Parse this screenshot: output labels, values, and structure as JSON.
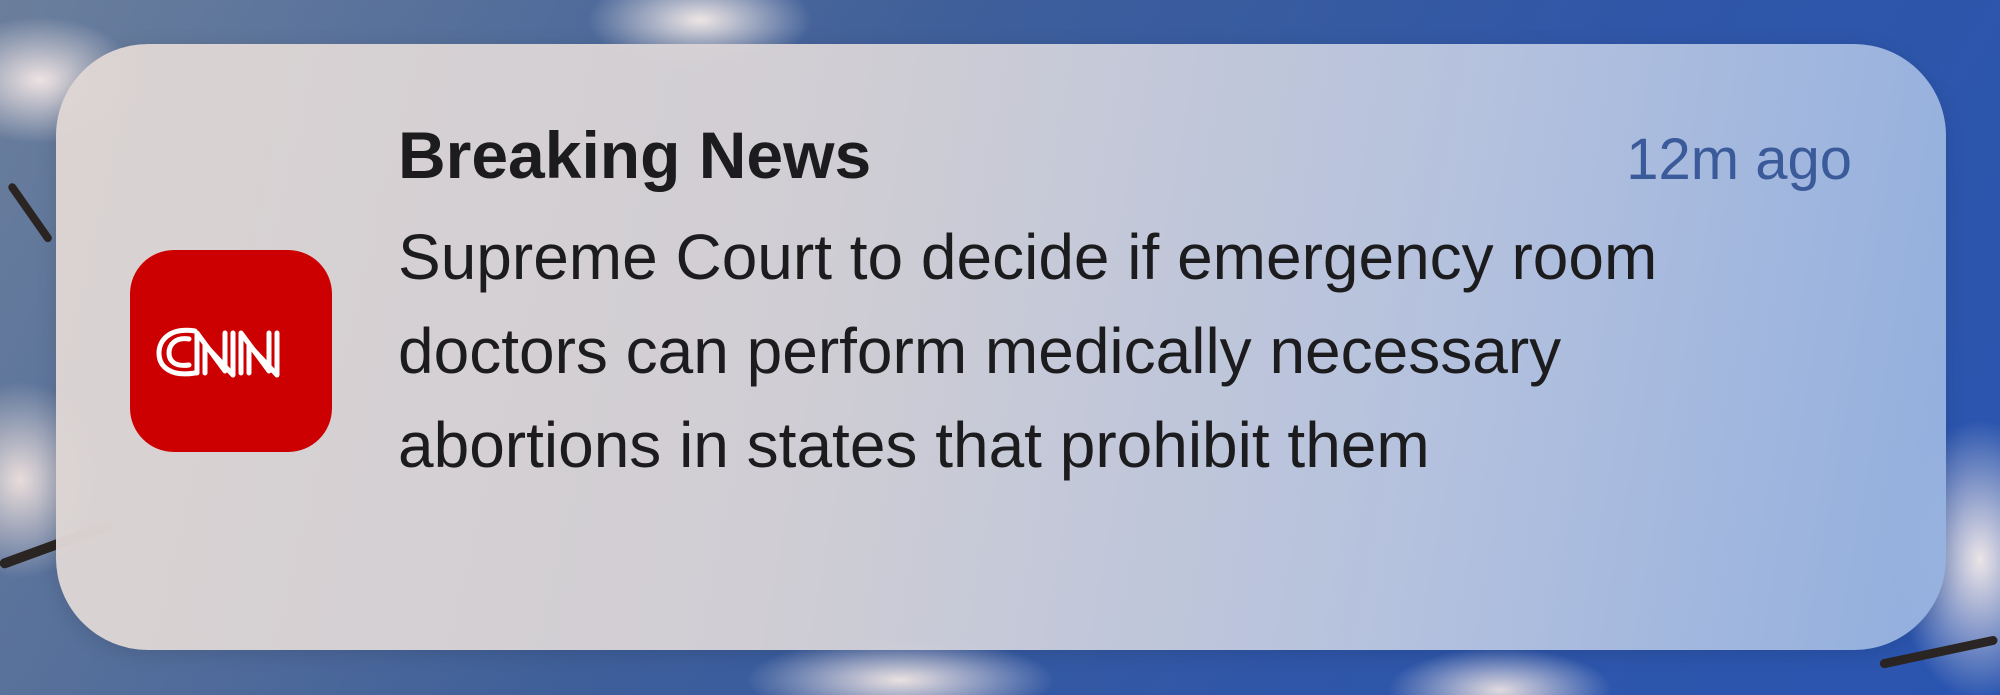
{
  "notification": {
    "app_name": "CNN",
    "title": "Breaking News",
    "time": "12m ago",
    "body": "Supreme Court to decide if emergency room doctors can perform medically necessary abortions in states that prohibit them"
  },
  "colors": {
    "app_icon_bg": "#cc0000",
    "time_text": "#3a5a9a",
    "title_text": "#1c1c1e"
  },
  "icons": {
    "app_icon": "cnn-logo-icon"
  }
}
